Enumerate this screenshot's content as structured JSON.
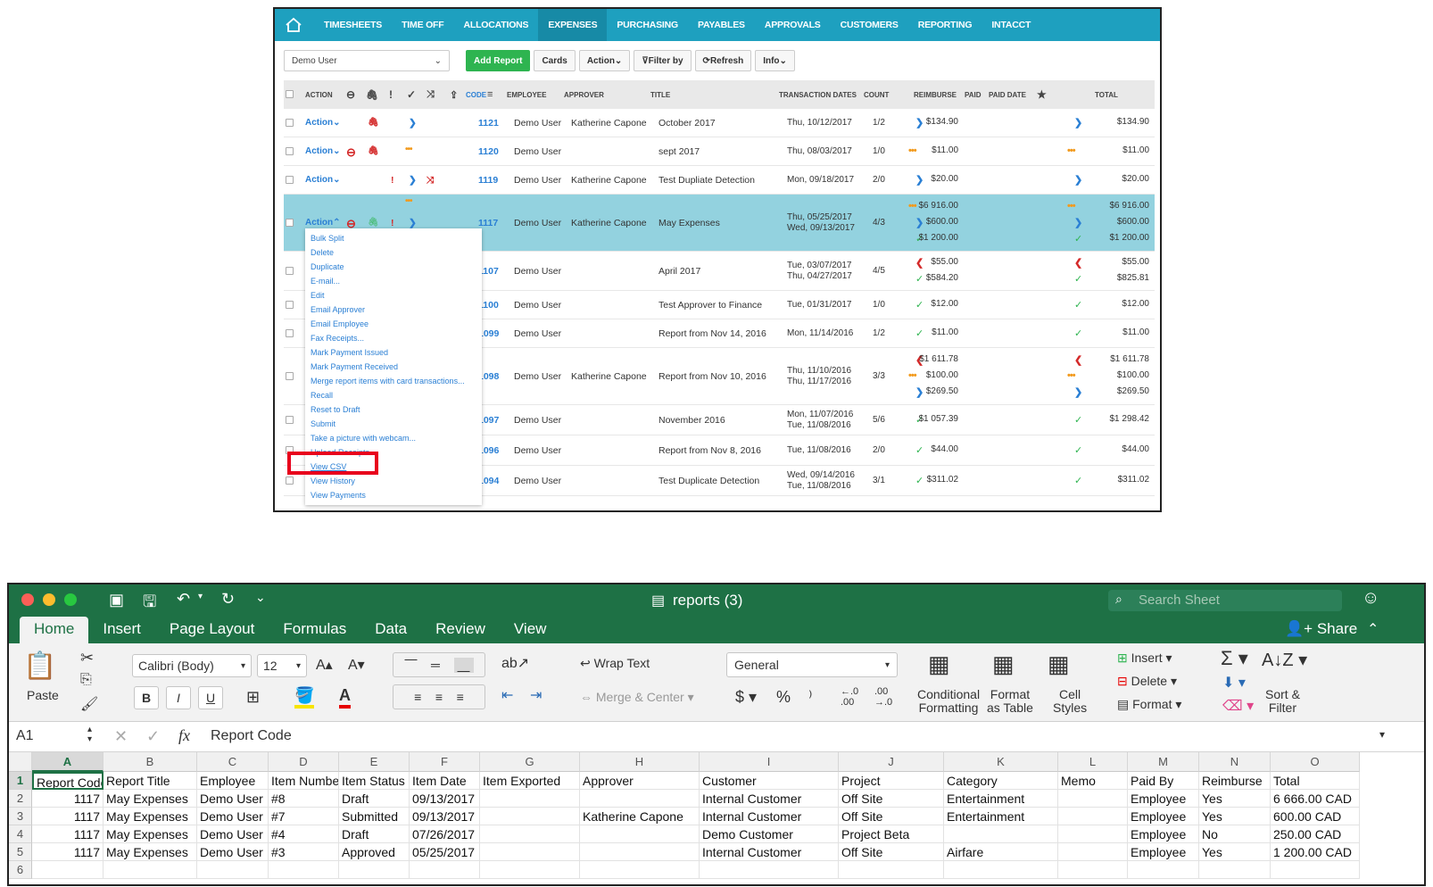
{
  "expense_app": {
    "nav": [
      "TIMESHEETS",
      "TIME OFF",
      "ALLOCATIONS",
      "EXPENSES",
      "PURCHASING",
      "PAYABLES",
      "APPROVALS",
      "CUSTOMERS",
      "REPORTING",
      "INTACCT"
    ],
    "active_nav": "EXPENSES",
    "toolbar": {
      "user_select": "Demo User",
      "add_report": "Add Report",
      "cards": "Cards",
      "action": "Action",
      "filter_by": "Filter by",
      "refresh": "Refresh",
      "info": "Info"
    },
    "columns": {
      "action": "ACTION",
      "code": "CODE",
      "employee": "EMPLOYEE",
      "approver": "APPROVER",
      "title": "TITLE",
      "transaction_dates": "TRANSACTION DATES",
      "count": "COUNT",
      "reimburse": "REIMBURSE",
      "paid": "PAID",
      "paid_date": "PAID DATE",
      "total": "TOTAL"
    },
    "action_label": "Action",
    "rows": [
      {
        "code": "1121",
        "employee": "Demo User",
        "approver": "Katherine Capone",
        "title": "October 2017",
        "dates": [
          "Thu, 10/12/2017"
        ],
        "count": "1/2",
        "reimburse": [
          [
            "arrow",
            "$134.90"
          ]
        ],
        "total": [
          [
            "arrow",
            "$134.90"
          ]
        ]
      },
      {
        "code": "1120",
        "employee": "Demo User",
        "approver": "",
        "title": "sept 2017",
        "dates": [
          "Thu, 08/03/2017"
        ],
        "count": "1/0",
        "reimburse": [
          [
            "dots",
            "$11.00"
          ]
        ],
        "total": [
          [
            "dots",
            "$11.00"
          ]
        ]
      },
      {
        "code": "1119",
        "employee": "Demo User",
        "approver": "Katherine Capone",
        "title": "Test Dupliate Detection",
        "dates": [
          "Mon, 09/18/2017"
        ],
        "count": "2/0",
        "reimburse": [
          [
            "arrow",
            "$20.00"
          ]
        ],
        "total": [
          [
            "arrow",
            "$20.00"
          ]
        ]
      },
      {
        "code": "1117",
        "employee": "Demo User",
        "approver": "Katherine Capone",
        "title": "May Expenses",
        "dates": [
          "Thu, 05/25/2017",
          "Wed, 09/13/2017"
        ],
        "count": "4/3",
        "reimburse": [
          [
            "dots",
            "$6 916.00"
          ],
          [
            "arrow",
            "$600.00"
          ],
          [
            "check",
            "$1 200.00"
          ]
        ],
        "total": [
          [
            "dots",
            "$6 916.00"
          ],
          [
            "arrow",
            "$600.00"
          ],
          [
            "check",
            "$1 200.00"
          ]
        ]
      },
      {
        "code": "1107",
        "employee": "Demo User",
        "approver": "",
        "title": "April 2017",
        "dates": [
          "Tue, 03/07/2017",
          "Thu, 04/27/2017"
        ],
        "count": "4/5",
        "reimburse": [
          [
            "back",
            "$55.00"
          ],
          [
            "check",
            "$584.20"
          ]
        ],
        "total": [
          [
            "back",
            "$55.00"
          ],
          [
            "check",
            "$825.81"
          ]
        ]
      },
      {
        "code": "1100",
        "employee": "Demo User",
        "approver": "",
        "title": "Test Approver to Finance",
        "dates": [
          "Tue, 01/31/2017"
        ],
        "count": "1/0",
        "reimburse": [
          [
            "check",
            "$12.00"
          ]
        ],
        "total": [
          [
            "check",
            "$12.00"
          ]
        ]
      },
      {
        "code": "1099",
        "employee": "Demo User",
        "approver": "",
        "title": "Report from Nov 14, 2016",
        "dates": [
          "Mon, 11/14/2016"
        ],
        "count": "1/2",
        "reimburse": [
          [
            "check",
            "$11.00"
          ]
        ],
        "total": [
          [
            "check",
            "$11.00"
          ]
        ]
      },
      {
        "code": "1098",
        "employee": "Demo User",
        "approver": "Katherine Capone",
        "title": "Report from Nov 10, 2016",
        "dates": [
          "Thu, 11/10/2016",
          "Thu, 11/17/2016"
        ],
        "count": "3/3",
        "reimburse": [
          [
            "back",
            "$1 611.78"
          ],
          [
            "dots",
            "$100.00"
          ],
          [
            "arrow",
            "$269.50"
          ]
        ],
        "total": [
          [
            "back",
            "$1 611.78"
          ],
          [
            "dots",
            "$100.00"
          ],
          [
            "arrow",
            "$269.50"
          ]
        ]
      },
      {
        "code": "1097",
        "employee": "Demo User",
        "approver": "",
        "title": "November 2016",
        "dates": [
          "Mon, 11/07/2016",
          "Tue, 11/08/2016"
        ],
        "count": "5/6",
        "reimburse": [
          [
            "check",
            "$1 057.39"
          ]
        ],
        "total": [
          [
            "check",
            "$1 298.42"
          ]
        ]
      },
      {
        "code": "1096",
        "employee": "Demo User",
        "approver": "",
        "title": "Report from Nov 8, 2016",
        "dates": [
          "Tue, 11/08/2016"
        ],
        "count": "2/0",
        "reimburse": [
          [
            "check",
            "$44.00"
          ]
        ],
        "total": [
          [
            "check",
            "$44.00"
          ]
        ]
      },
      {
        "code": "1094",
        "employee": "Demo User",
        "approver": "",
        "title": "Test Duplicate Detection",
        "dates": [
          "Wed, 09/14/2016",
          "Tue, 11/08/2016"
        ],
        "count": "3/1",
        "reimburse": [
          [
            "check",
            "$311.02"
          ]
        ],
        "total": [
          [
            "check",
            "$311.02"
          ]
        ]
      }
    ],
    "action_menu": [
      "Bulk Split",
      "Delete",
      "Duplicate",
      "E-mail...",
      "Edit",
      "Email Approver",
      "Email Employee",
      "Fax Receipts...",
      "Mark Payment Issued",
      "Mark Payment Received",
      "Merge report items with card transactions...",
      "Recall",
      "Reset to Draft",
      "Submit",
      "Take a picture with webcam...",
      "Upload Receipts",
      "View CSV",
      "View History",
      "View Payments"
    ],
    "highlighted_menu_item": "View CSV"
  },
  "excel": {
    "window_title": "reports (3)",
    "search_placeholder": "Search Sheet",
    "share": "Share",
    "tabs": [
      "Home",
      "Insert",
      "Page Layout",
      "Formulas",
      "Data",
      "Review",
      "View"
    ],
    "ribbon": {
      "paste": "Paste",
      "font": "Calibri (Body)",
      "font_size": "12",
      "bold": "B",
      "italic": "I",
      "underline": "U",
      "wrap_text": "Wrap Text",
      "merge_center": "Merge & Center",
      "number_format": "General",
      "conditional_formatting": [
        "Conditional",
        "Formatting"
      ],
      "format_as_table": [
        "Format",
        "as Table"
      ],
      "cell_styles": [
        "Cell",
        "Styles"
      ],
      "insert": "Insert",
      "delete": "Delete",
      "format": "Format",
      "sort_filter": [
        "Sort &",
        "Filter"
      ]
    },
    "name_box": "A1",
    "formula": "Report Code",
    "columns": [
      "A",
      "B",
      "C",
      "D",
      "E",
      "F",
      "G",
      "H",
      "I",
      "J",
      "K",
      "L",
      "M",
      "N",
      "O"
    ],
    "rows": [
      [
        "Report Code",
        "Report Title",
        "Employee",
        "Item Number",
        "Item Status",
        "Item Date",
        "Item Exported",
        "Approver",
        "Customer",
        "Project",
        "Category",
        "Memo",
        "Paid By",
        "Reimburse",
        "Total"
      ],
      [
        "1117",
        "May Expenses",
        "Demo User",
        "#8",
        "Draft",
        "09/13/2017",
        "",
        "",
        "Internal Customer",
        "Off Site",
        "Entertainment",
        "",
        "Employee",
        "Yes",
        "6 666.00 CAD"
      ],
      [
        "1117",
        "May Expenses",
        "Demo User",
        "#7",
        "Submitted",
        "09/13/2017",
        "",
        "Katherine Capone",
        "Internal Customer",
        "Off Site",
        "Entertainment",
        "",
        "Employee",
        "Yes",
        "600.00 CAD"
      ],
      [
        "1117",
        "May Expenses",
        "Demo User",
        "#4",
        "Draft",
        "07/26/2017",
        "",
        "",
        "Demo Customer",
        "Project Beta",
        "",
        "",
        "Employee",
        "No",
        "250.00 CAD"
      ],
      [
        "1117",
        "May Expenses",
        "Demo User",
        "#3",
        "Approved",
        "05/25/2017",
        "",
        "",
        "Internal Customer",
        "Off Site",
        "Airfare",
        "",
        "Employee",
        "Yes",
        "1 200.00 CAD"
      ],
      [
        "",
        "",
        "",
        "",
        "",
        "",
        "",
        "",
        "",
        "",
        "",
        "",
        "",
        "",
        ""
      ]
    ],
    "colors": {
      "excel_green": "#1e7145",
      "app_teal": "#1ea0bf",
      "highlight_red": "#e8001c"
    }
  }
}
